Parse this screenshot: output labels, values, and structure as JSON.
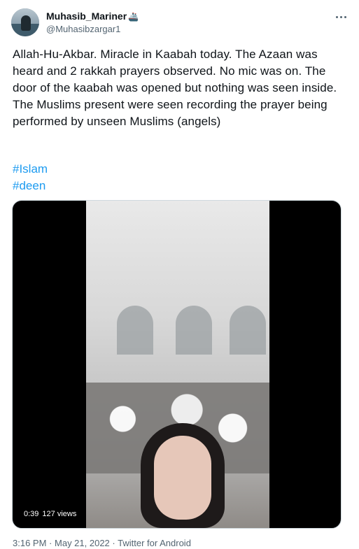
{
  "author": {
    "display_name": "Muhasib_Mariner",
    "badge_icon": "ship-icon",
    "handle": "@Muhasibzargar1"
  },
  "tweet": {
    "text": "Allah-Hu-Akbar. Miracle in Kaabah today. The Azaan was heard and 2 rakkah prayers observed. No mic was on. The door of the kaabah was opened but nothing was seen inside.  The Muslims present were seen recording the prayer being performed by unseen Muslims (angels)",
    "hashtags": [
      "#Islam",
      "#deen"
    ]
  },
  "video": {
    "duration": "0:39",
    "views": "127 views"
  },
  "meta": {
    "time": "3:16 PM",
    "separator": "·",
    "date": "May 21, 2022",
    "source": "Twitter for Android"
  },
  "colors": {
    "link": "#1d9bf0",
    "secondary": "#536471",
    "text": "#0f1419"
  }
}
